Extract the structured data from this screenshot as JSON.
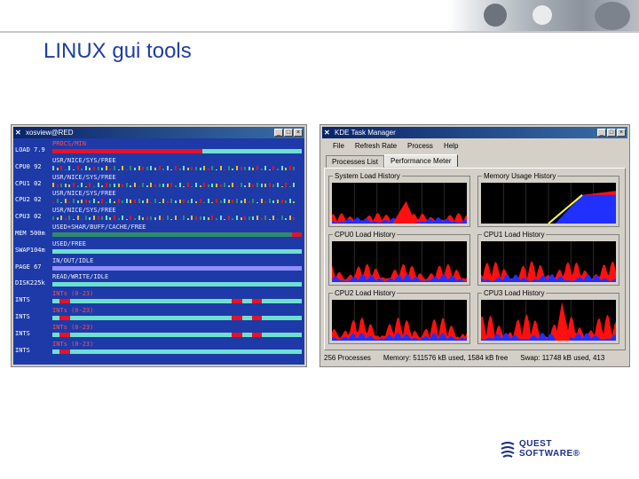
{
  "slide": {
    "title": "LINUX gui tools"
  },
  "xosview": {
    "window_title": "xosview@RED",
    "rows": [
      {
        "label": "LOAD 7.9",
        "caption": "PROCS/MIN",
        "caption_color": "#ff5050",
        "type": "bar",
        "fill": 0.6,
        "fill_color": "#e8102a"
      },
      {
        "label": "CPU0  92",
        "caption": "USR/NICE/SYS/FREE",
        "caption_color": "#e8e8ff",
        "type": "spark"
      },
      {
        "label": "CPU1  02",
        "caption": "USR/NICE/SYS/FREE",
        "caption_color": "#e8e8ff",
        "type": "spark"
      },
      {
        "label": "CPU2  02",
        "caption": "USR/NICE/SYS/FREE",
        "caption_color": "#e8e8ff",
        "type": "spark"
      },
      {
        "label": "CPU3  02",
        "caption": "USR/NICE/SYS/FREE",
        "caption_color": "#e8e8ff",
        "type": "spark"
      },
      {
        "label": "MEM 500m",
        "caption": "USED+SHAR/BUFF/CACHE/FREE",
        "caption_color": "#e8e8ff",
        "type": "bar",
        "fill": 0.96,
        "fill_color": "#2e8c6a",
        "end_color": "#e8102a"
      },
      {
        "label": "SWAP104m",
        "caption": "USED/FREE",
        "caption_color": "#e8e8ff",
        "type": "bar",
        "fill": 0.0,
        "fill_color": "#6fe0d0"
      },
      {
        "label": "PAGE 67",
        "caption": "IN/OUT/IDLE",
        "caption_color": "#e8e8ff",
        "type": "bar",
        "fill": 1.0,
        "fill_color": "#8f8fff"
      },
      {
        "label": "DISK225k",
        "caption": "READ/WRITE/IDLE",
        "caption_color": "#e8e8ff",
        "type": "bar",
        "fill": 0.0,
        "fill_color": "#6fe0d0"
      },
      {
        "label": "INTS",
        "caption": "INTs (0-23)",
        "caption_color": "#ff5050",
        "type": "ints",
        "marks": [
          0.03,
          0.72,
          0.8
        ]
      },
      {
        "label": "INTS",
        "caption": "INTs (0-23)",
        "caption_color": "#ff5050",
        "type": "ints",
        "marks": [
          0.03,
          0.72,
          0.8
        ]
      },
      {
        "label": "INTS",
        "caption": "INTs (0-23)",
        "caption_color": "#ff5050",
        "type": "ints",
        "marks": [
          0.03,
          0.72,
          0.8
        ]
      },
      {
        "label": "INTS",
        "caption": "INTs (0-23)",
        "caption_color": "#ff5050",
        "type": "ints",
        "marks": [
          0.03
        ]
      }
    ]
  },
  "ktm": {
    "window_title": "KDE Task Manager",
    "menu": [
      "File",
      "Refresh Rate",
      "Process",
      "Help"
    ],
    "tabs": [
      "Processes List",
      "Performance Meter"
    ],
    "active_tab": 1,
    "graphs": [
      {
        "title": "System Load History"
      },
      {
        "title": "Memory Usage History"
      },
      {
        "title": "CPU0 Load History"
      },
      {
        "title": "CPU1 Load History"
      },
      {
        "title": "CPU2 Load History"
      },
      {
        "title": "CPU3 Load History"
      }
    ],
    "status": {
      "processes": "256 Processes",
      "memory": "Memory: 511576 kB used, 1584 kB free",
      "swap": "Swap: 11748 kB used, 413"
    }
  },
  "logo": {
    "line1": "QUEST",
    "line2": "SOFTWARE®"
  },
  "colors": {
    "title": "#1f3f9f",
    "xo_bg": "#1d3aa8",
    "graph_red": "#ff1010",
    "graph_blue": "#2030ff"
  },
  "icons": {
    "window_icon": "x-window-icon",
    "minimize": "minimize-icon",
    "maximize": "maximize-icon",
    "close": "close-icon"
  }
}
